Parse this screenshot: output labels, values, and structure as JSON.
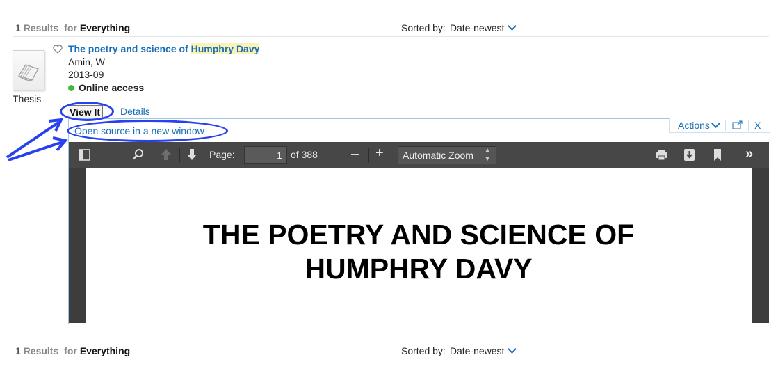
{
  "results_header_top": {
    "count": "1",
    "results_label": "Results",
    "for_label": "for",
    "scope": "Everything"
  },
  "sort_top": {
    "label": "Sorted by:",
    "value": "Date-newest"
  },
  "result": {
    "title_prefix": "The poetry and science of ",
    "title_highlight": "Humphry Davy",
    "author": "Amin, W",
    "date": "2013-09",
    "availability": "Online access",
    "resource_type": "Thesis",
    "tabs": {
      "view_it": "View It",
      "details": "Details"
    }
  },
  "viewer_panel": {
    "open_source_link": "Open source in a new window",
    "actions_label": "Actions",
    "close_label": "X"
  },
  "pdf_toolbar": {
    "page_label": "Page:",
    "page_value": "1",
    "page_of": "of 388",
    "zoom_minus": "–",
    "zoom_plus": "+",
    "zoom_value": "Automatic Zoom"
  },
  "pdf_page": {
    "title_line1": "THE POETRY AND SCIENCE OF",
    "title_line2": "HUMPHRY DAVY"
  },
  "results_header_bottom": {
    "count": "1",
    "results_label": "Results",
    "for_label": "for",
    "scope": "Everything"
  },
  "sort_bottom": {
    "label": "Sorted by:",
    "value": "Date-newest"
  },
  "colors": {
    "link": "#1a6fb8",
    "annotation": "#2740f0",
    "online": "#3cba3c",
    "toolbar": "#474747"
  }
}
